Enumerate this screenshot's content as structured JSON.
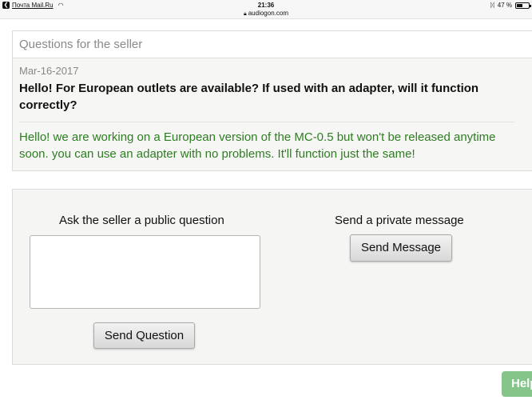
{
  "status_bar": {
    "back_app": "Почта Mail.Ru",
    "time": "21:36",
    "url": "audiogon.com",
    "battery": "47 %",
    "battery_level": 0.47,
    "icons": [
      "back-arrow-icon",
      "wifi-icon",
      "lock-icon",
      "bluetooth-icon",
      "battery-icon"
    ]
  },
  "qa": {
    "header": "Questions for the seller",
    "entries": [
      {
        "date": "Mar-16-2017",
        "question": "Hello! For European outlets are available? If used with an adapter, will it function correctly?",
        "answer": "Hello! we are working on a European version of the MC-0.5 but won't be released anytime soon. you can use an adapter with no problems. It'll function just the same!"
      }
    ]
  },
  "ask": {
    "public_title": "Ask the seller a public question",
    "textarea_value": "",
    "send_question_label": "Send Question",
    "private_title": "Send a private message",
    "send_message_label": "Send Message"
  },
  "help": {
    "label": "Help"
  },
  "colors": {
    "answer_text": "#2e7d22",
    "help_button": "#85c58a",
    "panel_bg": "#f5f5f3"
  }
}
